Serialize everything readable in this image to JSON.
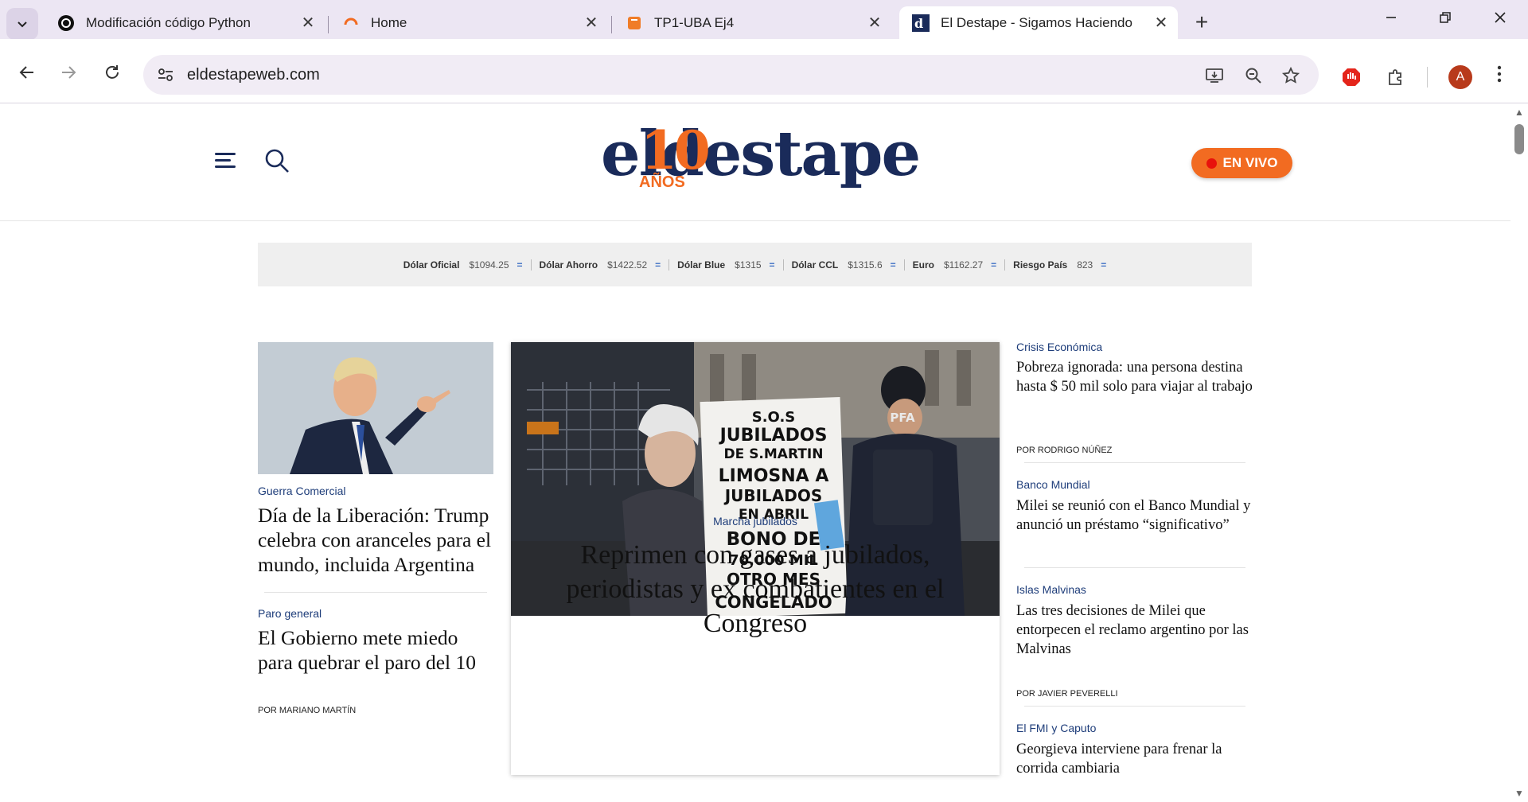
{
  "browser": {
    "tabs": [
      {
        "title": "Modificación código Python",
        "close": "✕"
      },
      {
        "title": "Home",
        "close": "✕"
      },
      {
        "title": "TP1-UBA Ej4",
        "close": "✕"
      },
      {
        "title": "El Destape - Sigamos Haciendo",
        "close": "✕"
      }
    ],
    "new_tab": "+",
    "url": "eldestapeweb.com",
    "avatar_letter": "A"
  },
  "site": {
    "logo_brand": "eldestape",
    "logo_ten": "10",
    "logo_anos": "AÑOS",
    "live_label": "EN VIVO",
    "accent_color": "#f26b21",
    "navy_color": "#1a2b5a"
  },
  "ticker": [
    {
      "label": "Dólar Oficial",
      "value": "$1094.25",
      "change": "="
    },
    {
      "label": "Dólar Ahorro",
      "value": "$1422.52",
      "change": "="
    },
    {
      "label": "Dólar Blue",
      "value": "$1315",
      "change": "="
    },
    {
      "label": "Dólar CCL",
      "value": "$1315.6",
      "change": "="
    },
    {
      "label": "Euro",
      "value": "$1162.27",
      "change": "="
    },
    {
      "label": "Riesgo País",
      "value": "823",
      "change": "="
    }
  ],
  "left": {
    "story1": {
      "kicker": "Guerra Comercial",
      "headline": "Día de la Liberación: Trump celebra con aranceles para el mundo, incluida Argentina"
    },
    "story2": {
      "kicker": "Paro general",
      "headline": "El Gobierno mete miedo para quebrar el paro del 10",
      "byline": "Por MARIANO MARTÍN"
    }
  },
  "main": {
    "kicker": "Marcha jubilados",
    "headline": "Reprimen con gases a jubilados, periodistas y ex combatientes en el Congreso",
    "sign_text": [
      "S.O.S",
      "JUBILADOS",
      "DE S.MARTIN",
      "LIMOSNA A",
      "JUBILADOS",
      "EN ABRIL",
      "BONO DE",
      "70.000 MIL",
      "OTRO MES",
      "CONGELADO"
    ],
    "badge_text": "PFA"
  },
  "right": [
    {
      "kicker": "Crisis Económica",
      "headline": "Pobreza ignorada: una persona destina hasta $ 50 mil solo para viajar al trabajo",
      "byline": "Por RODRIGO NÚÑEZ"
    },
    {
      "kicker": "Banco Mundial",
      "headline": "Milei se reunió con el Banco Mundial y anunció un préstamo “significativo”",
      "byline": ""
    },
    {
      "kicker": "Islas Malvinas",
      "headline": "Las tres decisiones de Milei que entorpecen el reclamo argentino por las Malvinas",
      "byline": "Por JAVIER PEVERELLI"
    },
    {
      "kicker": "El FMI y Caputo",
      "headline": "Georgieva interviene para frenar la corrida cambiaria",
      "byline": ""
    }
  ]
}
